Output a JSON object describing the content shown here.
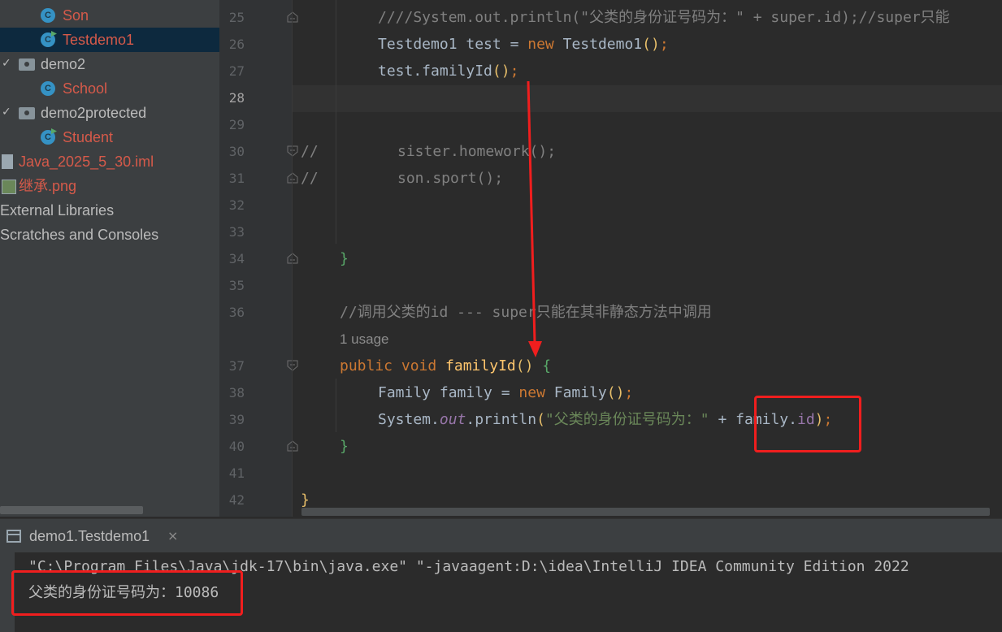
{
  "project_tree": {
    "items": [
      {
        "label": "Son",
        "icon": "java-class-icon",
        "color": "#d65a4a"
      },
      {
        "label": "Testdemo1",
        "icon": "runnable-java-class-icon",
        "color": "#d65a4a",
        "selected": true
      },
      {
        "label": "demo2",
        "icon": "package-folder-icon"
      },
      {
        "label": "School",
        "icon": "java-class-icon",
        "color": "#d65a4a"
      },
      {
        "label": "demo2protected",
        "icon": "package-folder-icon"
      },
      {
        "label": "Student",
        "icon": "runnable-java-class-icon",
        "color": "#d65a4a"
      },
      {
        "label": "Java_2025_5_30.iml",
        "icon": "iml-file-icon",
        "color": "#d65a4a"
      },
      {
        "label": "继承.png",
        "icon": "image-file-icon",
        "color": "#d65a4a"
      },
      {
        "label": "External Libraries",
        "icon": "libraries-icon"
      },
      {
        "label": "Scratches and Consoles",
        "icon": "scratches-icon"
      }
    ]
  },
  "editor": {
    "line_numbers": [
      "25",
      "26",
      "27",
      "28",
      "29",
      "30",
      "31",
      "32",
      "33",
      "34",
      "35",
      "36",
      "37",
      "38",
      "39",
      "40",
      "41",
      "42"
    ],
    "current_line": "28",
    "lines": {
      "l25": "////System.out.println(\"父类的身份证号码为：\" + super.id);//super只能",
      "l26_type": "Testdemo1",
      "l26_var": " test = ",
      "l26_new": "new",
      "l26_ctor": " Testdemo1",
      "l26_end": ";",
      "l27_obj": "test.familyId",
      "l27_end": ";",
      "l30_cmt": "//",
      "l30_code": "sister.homework();",
      "l31_cmt": "//",
      "l31_code": "son.sport();",
      "l34": "}",
      "l36": "//调用父类的id --- super只能在其非静态方法中调用",
      "usage_hint": "1 usage",
      "l37_mods": "public void ",
      "l37_name": "familyId",
      "l37_end": " {",
      "l38_type": "Family family = ",
      "l38_new": "new",
      "l38_ctor": " Family",
      "l38_end": ";",
      "l39_sys": "System.",
      "l39_out": "out",
      "l39_call": ".println",
      "l39_str": "\"父类的身份证号码为：\"",
      "l39_plus": " + ",
      "l39_obj": "family.",
      "l39_fld": "id",
      "l39_end": ";",
      "l40": "}",
      "l42": "}",
      "paren_open": "(",
      "paren_close": ")",
      "parens": "()"
    }
  },
  "run_panel": {
    "tab_label": "demo1.Testdemo1",
    "close_glyph": "×",
    "console_lines": [
      "\"C:\\Program Files\\Java\\jdk-17\\bin\\java.exe\" \"-javaagent:D:\\idea\\IntelliJ IDEA Community Edition 2022",
      "父类的身份证号码为：10086"
    ]
  },
  "annotation_color": "#f01e1e"
}
